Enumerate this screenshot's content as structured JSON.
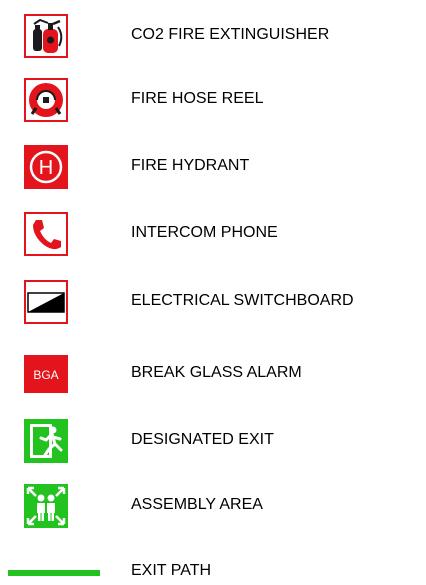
{
  "legend": {
    "items": [
      {
        "label": "CO2 FIRE EXTINGUISHER",
        "icon": "fire-extinguisher-icon"
      },
      {
        "label": "FIRE HOSE REEL",
        "icon": "hose-reel-icon"
      },
      {
        "label": "FIRE HYDRANT",
        "icon": "hydrant-icon",
        "icon_text": "H"
      },
      {
        "label": "INTERCOM PHONE",
        "icon": "phone-icon"
      },
      {
        "label": "ELECTRICAL SWITCHBOARD",
        "icon": "switchboard-icon"
      },
      {
        "label": "BREAK GLASS ALARM",
        "icon": "break-glass-alarm-icon",
        "icon_text": "BGA"
      },
      {
        "label": "DESIGNATED EXIT",
        "icon": "exit-sign-icon"
      },
      {
        "label": "ASSEMBLY AREA",
        "icon": "assembly-area-icon"
      },
      {
        "label": "EXIT PATH",
        "icon": "exit-path-line"
      }
    ],
    "colors": {
      "fire_red": "#e3141b",
      "exit_green": "#22c21f",
      "black": "#000000",
      "white": "#ffffff"
    }
  }
}
